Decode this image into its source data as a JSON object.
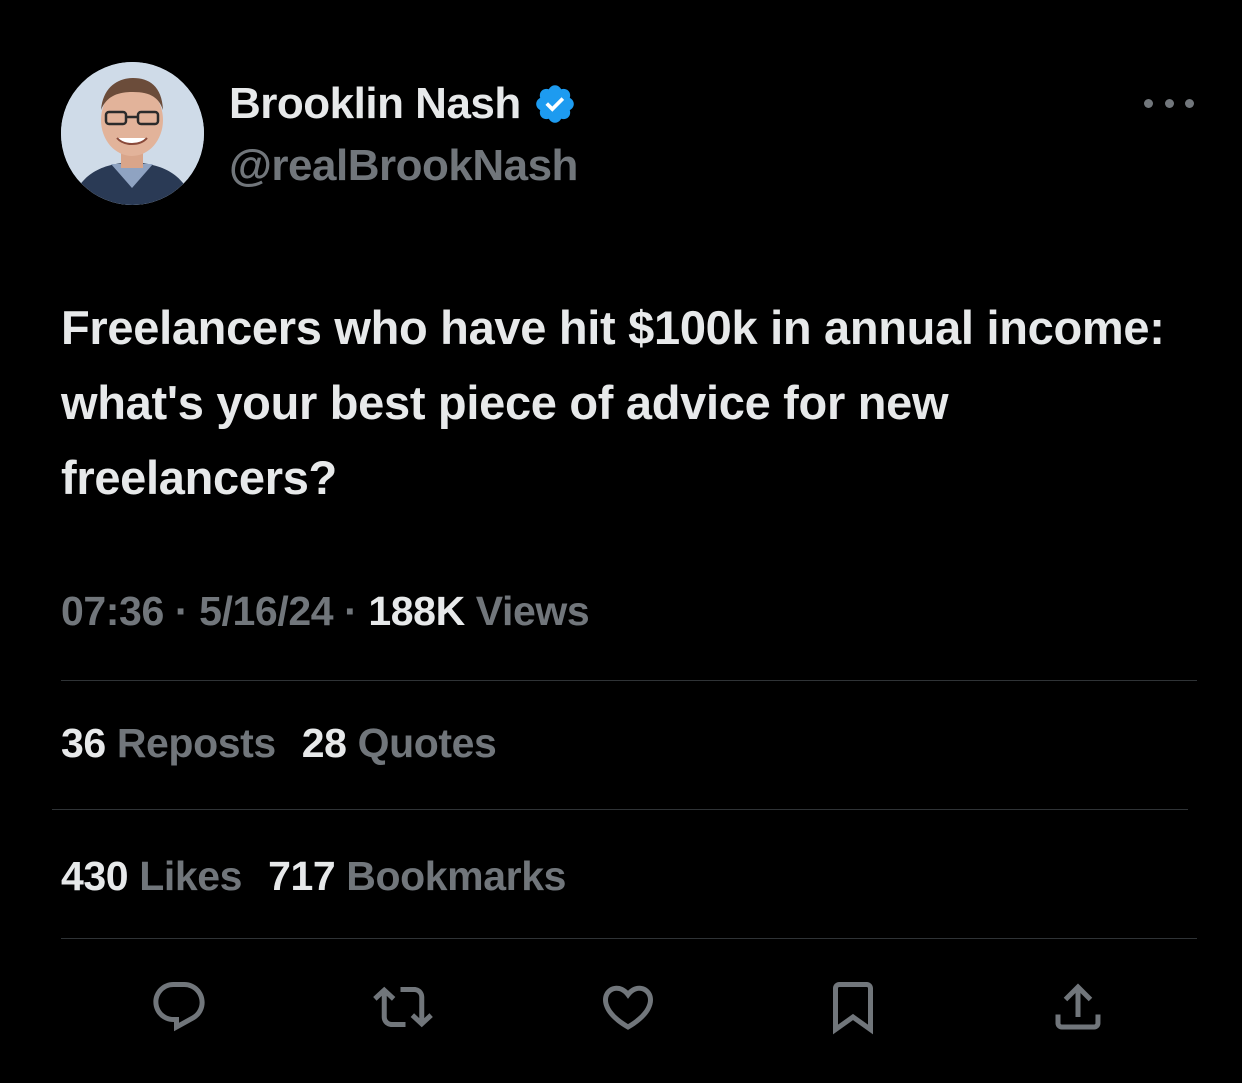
{
  "author": {
    "display_name": "Brooklin Nash",
    "handle": "@realBrookNash",
    "verified_icon": "verified-badge-icon",
    "verified_color": "#1d9bf0"
  },
  "tweet": {
    "text": "Freelancers who have hit $100k in annual income: what's your best piece of advice for new freelancers?"
  },
  "meta": {
    "time": "07:36",
    "sep1": " · ",
    "date": "5/16/24",
    "sep2": " · ",
    "views_count": "188K",
    "views_label": "Views"
  },
  "stats": {
    "reposts_count": "36",
    "reposts_label": "Reposts",
    "quotes_count": "28",
    "quotes_label": "Quotes",
    "likes_count": "430",
    "likes_label": "Likes",
    "bookmarks_count": "717",
    "bookmarks_label": "Bookmarks"
  },
  "actions": [
    "reply-icon",
    "repost-icon",
    "like-icon",
    "bookmark-icon",
    "share-icon"
  ],
  "colors": {
    "background": "#000000",
    "text_primary": "#e7e9ea",
    "text_secondary": "#71767b",
    "divider": "#2f3336"
  }
}
